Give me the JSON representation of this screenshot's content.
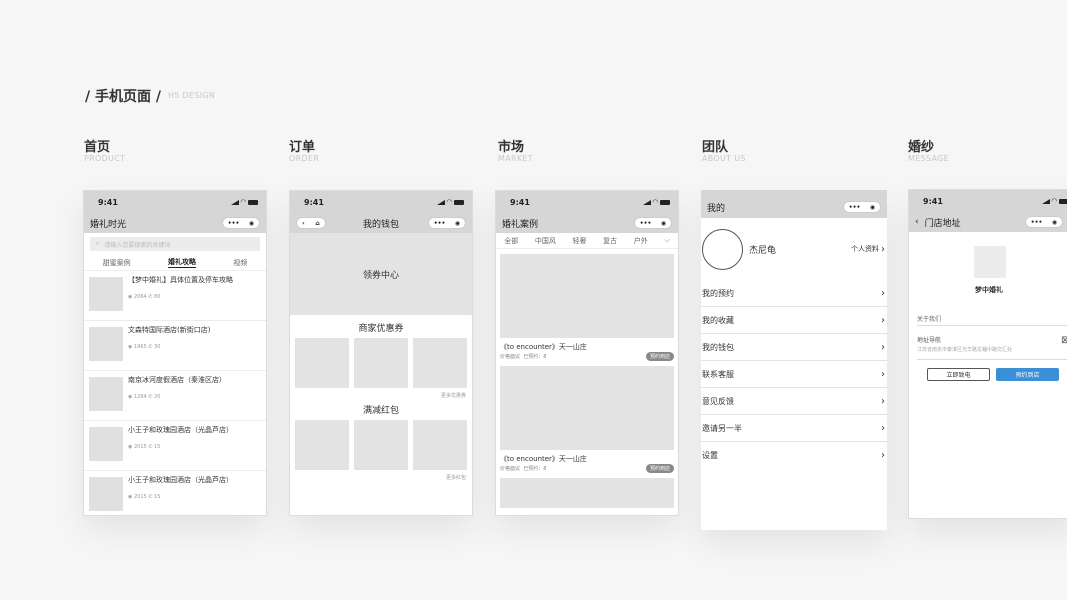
{
  "header": {
    "main": "/ 手机页面 /",
    "sub": "H5 DESIGN"
  },
  "columns": [
    {
      "title": "首页",
      "sub": "PRODUCT"
    },
    {
      "title": "订单",
      "sub": "ORDER"
    },
    {
      "title": "市场",
      "sub": "MARKET"
    },
    {
      "title": "团队",
      "sub": "ABOUT US"
    },
    {
      "title": "婚纱",
      "sub": "MESSAGE"
    }
  ],
  "status_time": "9:41",
  "capsule": {
    "dots": "•••",
    "target": "◉"
  },
  "home": {
    "title": "婚礼时光",
    "search_placeholder": "请输入您要搜索的关键词",
    "tabs": [
      "甜蜜案例",
      "婚礼攻略",
      "视频"
    ],
    "active_tab": "婚礼攻略",
    "items": [
      {
        "title": "【梦中婚礼】具体位置及停车攻略",
        "meta": "◉ 2064 ✆ 80"
      },
      {
        "title": "文森特国际酒店(新街口店)",
        "meta": "◉ 1965 ✆ 30"
      },
      {
        "title": "南京冰河度假酒店（秦淮区店）",
        "meta": "◉ 1264 ✆ 20"
      },
      {
        "title": "小王子和玫瑰园酒店（光晶芦店）",
        "meta": "◉ 2015 ✆ 15"
      },
      {
        "title": "小王子和玫瑰园酒店（光晶芦店）",
        "meta": "◉ 2015 ✆ 15"
      }
    ]
  },
  "order": {
    "title": "我的钱包",
    "coupon_center": "领券中心",
    "merchant_coupons": "商家优惠券",
    "more_coupons": "更多优惠券",
    "discount_red": "满减红包",
    "more_red": "更多红包"
  },
  "market": {
    "title": "婚礼案例",
    "tabs": [
      "全部",
      "中国风",
      "轻奢",
      "复古",
      "户外",
      "⌵"
    ],
    "cards": [
      {
        "title": "《to encounter》天一山庄",
        "price": "价格面议",
        "booked": "已预约：8",
        "badge": "预约到店"
      },
      {
        "title": "《to encounter》天一山庄",
        "price": "价格面议",
        "booked": "已预约：8",
        "badge": "预约到店"
      }
    ]
  },
  "team": {
    "title": "我的",
    "name": "杰尼龟",
    "profile": "个人资料",
    "menu": [
      "我的预约",
      "我的收藏",
      "我的钱包",
      "联系客服",
      "意见反馈",
      "邀请另一半",
      "设置"
    ]
  },
  "dress": {
    "title": "门店地址",
    "store": "梦中婚礼",
    "about": "关于我们",
    "nav_label": "地址导航",
    "nav_text": "江苏省南京市秦淮区光华路龙蟠中路交汇处",
    "btn_call": "立即致电",
    "btn_visit": "预约到店",
    "accent": "#3a8fd6"
  }
}
